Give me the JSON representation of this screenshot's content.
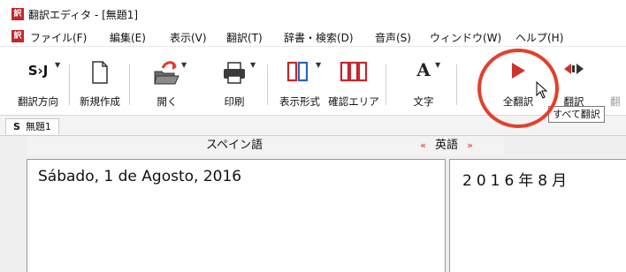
{
  "window": {
    "title": "翻訳エディタ - [無題1]",
    "app_icon_glyph": "訳"
  },
  "menubar": {
    "icon_glyph": "訳",
    "items": [
      {
        "label": "ファイル(F)"
      },
      {
        "label": "編集(E)"
      },
      {
        "label": "表示(V)"
      },
      {
        "label": "翻訳(T)"
      },
      {
        "label": "辞書・検索(D)"
      },
      {
        "label": "音声(S)"
      },
      {
        "label": "ウィンドウ(W)"
      },
      {
        "label": "ヘルプ(H)"
      }
    ]
  },
  "toolbar": {
    "direction": {
      "icon_text": "S›J",
      "label": "翻訳方向"
    },
    "new_doc": {
      "label": "新規作成"
    },
    "open": {
      "label": "開く"
    },
    "print": {
      "label": "印刷"
    },
    "display_format": {
      "label": "表示形式"
    },
    "confirm_area": {
      "label": "確認エリア"
    },
    "text": {
      "icon_text": "A",
      "label": "文字"
    },
    "translate_all": {
      "label": "全翻訳"
    },
    "translate": {
      "label": "翻訳"
    },
    "truncated_next": {
      "label": "翻"
    }
  },
  "tooltip": {
    "text": "すべて翻訳"
  },
  "tabs": [
    {
      "marker": "S",
      "label": "無題1"
    }
  ],
  "editor": {
    "source_language": "スペイン語",
    "target_language": "英語",
    "target_arrow_left": "«",
    "target_arrow_right": "»",
    "source_text": "Sábado, 1 de Agosto, 2016",
    "target_text": "2016年8月"
  },
  "colors": {
    "accent": "#c2272d",
    "highlight": "#e2402b",
    "arrow": "#d0312d"
  }
}
